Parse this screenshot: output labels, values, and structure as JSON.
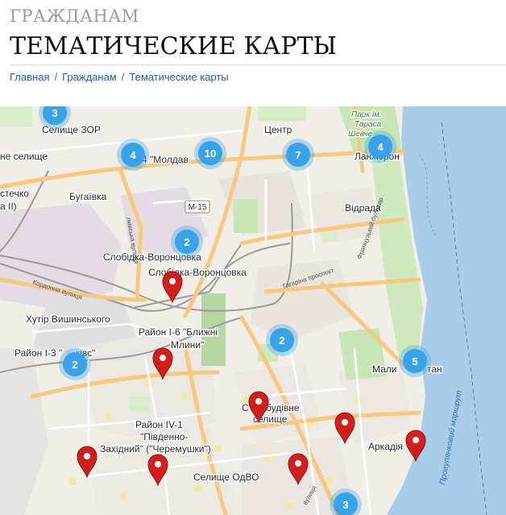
{
  "header": {
    "section": "ГРАЖДАНАМ",
    "title": "ТЕМАТИЧЕСКИЕ КАРТЫ"
  },
  "breadcrumb": [
    "Главная",
    "Гражданам",
    "Тематические карты"
  ],
  "map": {
    "place_labels": {
      "selyshche_zor": "Селище ЗОР",
      "ne_selyshche": "не селище",
      "moldav": "-4 \"Молдав",
      "tsentr": "Центр",
      "park_line1": "Парк ім.",
      "park_line2": "Тараса",
      "park_line3": "Шевче",
      "lanzheron": "Ланжерон",
      "stechko": "стечко",
      "stechko_sub": "а II)",
      "buhaivka": "Бугаївка",
      "m15": "М-15",
      "vidrada": "Відрада",
      "slobidka_1": "Слобідка-Воронцовка",
      "slobidka_2": "Слобідка-Воронцовка",
      "khutir": "Хутір Вишинського",
      "rayon_i6_1": "Район І-6 \"Ближні",
      "rayon_i6_2": "Млини\"",
      "rayon_i3": "Район І-3 \"",
      "rayon_i3_b": "ківс\"",
      "maly": "Мали",
      "fontan": "тан",
      "sun_1": "С",
      "sun_2": "будівне",
      "selyshche": "селище",
      "rayon_iv1_1": "Район IV-1",
      "rayon_iv1_2": "\"Південно-",
      "rayon_iv1_3": "Західний\" (\"Черемушки\")",
      "arkadiia": "Аркадія",
      "selyshche_odvo": "Селище ОдВО"
    },
    "street_labels": {
      "kordonna": "Кордонна вулиця",
      "haharina": "Гагаріна проспект",
      "frantsuzky": "Французький бульвар",
      "prylivka": "лківська вулиця",
      "route": "Прогулянковий маршрут",
      "vul": "вулиця"
    },
    "clusters": [
      {
        "count": "3"
      },
      {
        "count": "4"
      },
      {
        "count": "10"
      },
      {
        "count": "7"
      },
      {
        "count": "4"
      },
      {
        "count": "2"
      },
      {
        "count": "2"
      },
      {
        "count": "2"
      },
      {
        "count": "5"
      },
      {
        "count": "3"
      }
    ],
    "marker_color": "#d1201c",
    "cluster_color": "#3aa3e8",
    "water_color": "#a9cde8"
  }
}
